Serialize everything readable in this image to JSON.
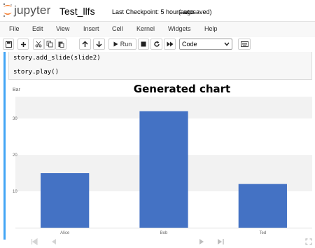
{
  "header": {
    "logo_text": "jupyter",
    "notebook_name": "Test_llfs",
    "checkpoint": "Last Checkpoint: 5 hours ago",
    "autosave": "(autosaved)"
  },
  "menu": [
    "File",
    "Edit",
    "View",
    "Insert",
    "Cell",
    "Kernel",
    "Widgets",
    "Help"
  ],
  "toolbar": {
    "run_label": "Run",
    "cell_type": "Code"
  },
  "cell": {
    "lines": [
      "story.add_slide(slide2)",
      "",
      "story.play()"
    ]
  },
  "colors": {
    "bar": "#4472c4",
    "cell_selected": "#42a5f5",
    "grid_band": "#f2f2f2"
  },
  "chart_data": {
    "type": "bar",
    "title": "Generated chart",
    "ylabel": "Bar",
    "categories": [
      "Alice",
      "Bob",
      "Ted"
    ],
    "values": [
      15,
      32,
      12
    ],
    "ylim": [
      0,
      36
    ],
    "yticks": [
      10,
      20,
      30
    ],
    "grid": true
  }
}
